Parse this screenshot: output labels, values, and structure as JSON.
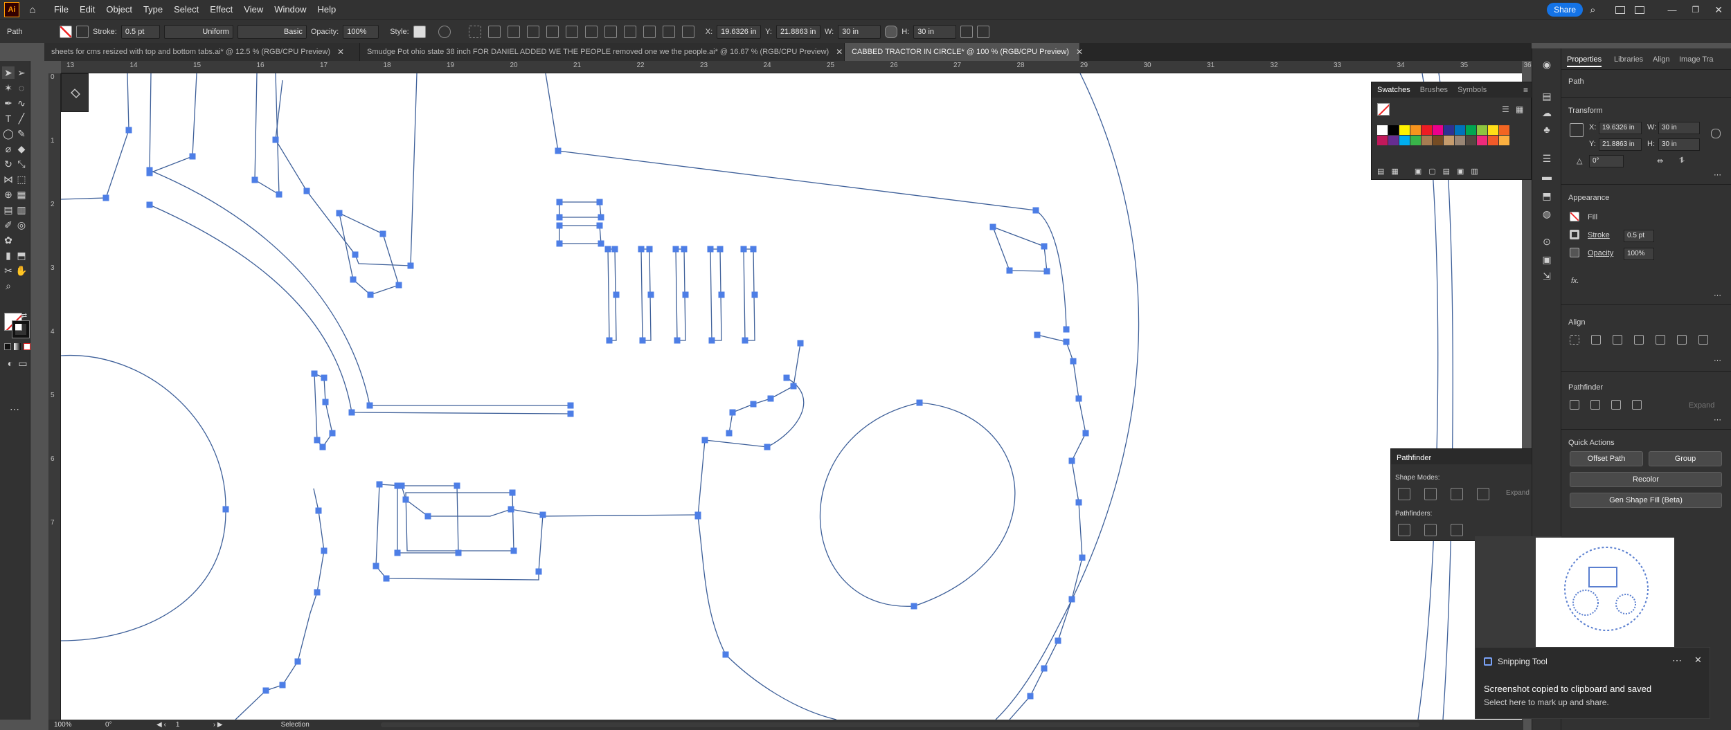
{
  "app": {
    "logo": "Ai",
    "share_label": "Share"
  },
  "menu": [
    "File",
    "Edit",
    "Object",
    "Type",
    "Select",
    "Effect",
    "View",
    "Window",
    "Help"
  ],
  "control_bar": {
    "selection_type": "Path",
    "stroke_label": "Stroke:",
    "stroke_value": "0.5 pt",
    "profile_value": "Uniform",
    "brush_value": "Basic",
    "opacity_label": "Opacity:",
    "opacity_value": "100%",
    "style_label": "Style:",
    "x_label": "X:",
    "x_value": "19.6326 in",
    "y_label": "Y:",
    "y_value": "21.8863 in",
    "w_label": "W:",
    "w_value": "30 in",
    "h_label": "H:",
    "h_value": "30 in"
  },
  "tabs": [
    {
      "label": "sheets for cms resized with top and bottom tabs.ai* @ 12.5 % (RGB/CPU Preview)",
      "active": false
    },
    {
      "label": "Smudge Pot ohio state 38 inch FOR DANIEL ADDED WE THE PEOPLE removed one we the people.ai* @ 16.67 % (RGB/CPU Preview)",
      "active": false
    },
    {
      "label": "CABBED TRACTOR IN CIRCLE* @ 100 % (RGB/CPU Preview)",
      "active": true
    }
  ],
  "ruler_top": [
    "13",
    "14",
    "15",
    "16",
    "17",
    "18",
    "19",
    "20",
    "21",
    "22",
    "23",
    "24",
    "25",
    "26",
    "27",
    "28",
    "29",
    "30",
    "31",
    "32",
    "33",
    "34",
    "35",
    "36"
  ],
  "ruler_left": [
    "0",
    "1",
    "2",
    "3",
    "4",
    "5",
    "6",
    "7"
  ],
  "status": {
    "zoom": "100%",
    "rotation": "0°",
    "artboard": "1",
    "tool": "Selection"
  },
  "properties": {
    "tabs": [
      "Properties",
      "Libraries",
      "Align",
      "Image Tra"
    ],
    "object_type": "Path",
    "transform_title": "Transform",
    "x_label": "X:",
    "x_value": "19.6326 in",
    "y_label": "Y:",
    "y_value": "21.8863 in",
    "w_label": "W:",
    "w_value": "30 in",
    "h_label": "H:",
    "h_value": "30 in",
    "rotate_value": "0°",
    "appearance_title": "Appearance",
    "fill_label": "Fill",
    "stroke_label": "Stroke",
    "stroke_value": "0.5 pt",
    "opacity_label": "Opacity",
    "opacity_value": "100%",
    "fx_label": "fx.",
    "align_title": "Align",
    "pathfinder_title": "Pathfinder",
    "expand_label": "Expand",
    "quick_actions_title": "Quick Actions",
    "offset_path": "Offset Path",
    "group": "Group",
    "recolor": "Recolor",
    "gen_shape_fill": "Gen Shape Fill (Beta)"
  },
  "swatches_panel": {
    "tabs": [
      "Swatches",
      "Brushes",
      "Symbols"
    ],
    "colors": [
      "#ffffff",
      "#000000",
      "#fff200",
      "#f7941d",
      "#ed1c24",
      "#ec008c",
      "#2e3192",
      "#0072bc",
      "#00a651",
      "#8dc63f",
      "#ffde17",
      "#f26522",
      "#c2185b",
      "#662d91",
      "#00aeef",
      "#39b54a",
      "#a67c52",
      "#754c24",
      "#c69c6d",
      "#998675",
      "#534741",
      "#ee2a7b",
      "#f15a29",
      "#fbb040"
    ]
  },
  "pathfinder_panel": {
    "title": "Pathfinder",
    "shape_modes": "Shape Modes:",
    "pathfinders": "Pathfinders:",
    "expand": "Expand"
  },
  "toast": {
    "app": "Snipping Tool",
    "title": "Screenshot copied to clipboard and saved",
    "subtitle": "Select here to mark up and share."
  }
}
